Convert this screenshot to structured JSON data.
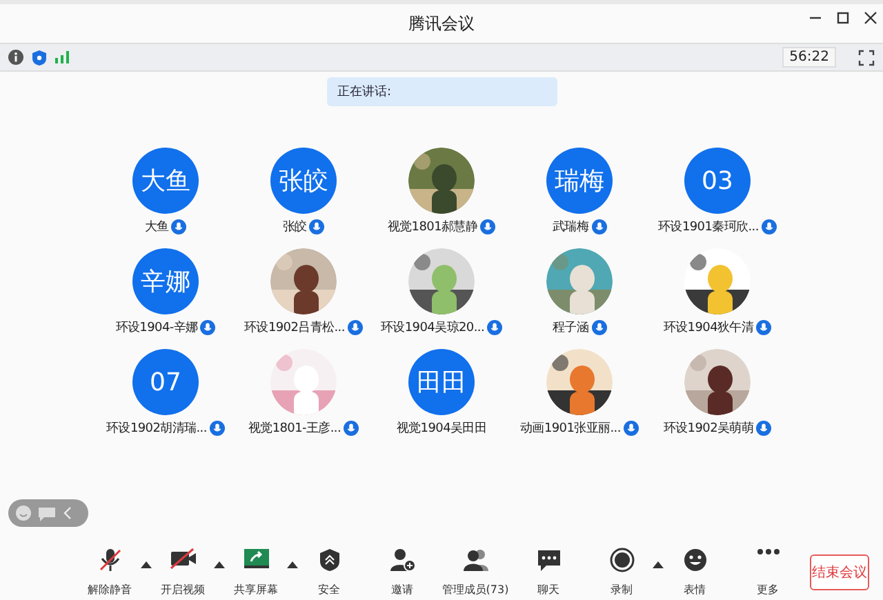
{
  "window": {
    "title": "腾讯会议"
  },
  "info_bar": {
    "timer": "56:22"
  },
  "speaking": {
    "label": "正在讲话:"
  },
  "participants": [
    {
      "name": "大鱼",
      "kind": "initials",
      "initials": "大鱼",
      "mic": true
    },
    {
      "name": "张皎",
      "kind": "initials",
      "initials": "张皎",
      "mic": true
    },
    {
      "name": "视觉1801郝慧静",
      "kind": "picture",
      "mic": true
    },
    {
      "name": "武瑞梅",
      "kind": "initials",
      "initials": "瑞梅",
      "mic": true
    },
    {
      "name": "环设1901秦珂欣...",
      "kind": "initials",
      "initials": "03",
      "mic": true
    },
    {
      "name": "环设1904-辛娜",
      "kind": "initials",
      "initials": "辛娜",
      "mic": true
    },
    {
      "name": "环设1902吕青松...",
      "kind": "picture",
      "mic": true
    },
    {
      "name": "环设1904吴琼20...",
      "kind": "picture",
      "mic": true
    },
    {
      "name": "程子涵",
      "kind": "picture",
      "mic": true
    },
    {
      "name": "环设1904狄午清",
      "kind": "picture",
      "mic": true
    },
    {
      "name": "环设1902胡清瑞...",
      "kind": "initials",
      "initials": "07",
      "mic": true
    },
    {
      "name": "视觉1801-王彦...",
      "kind": "picture",
      "mic": true
    },
    {
      "name": "视觉1904吴田田",
      "kind": "initials",
      "initials": "田田",
      "mic": false
    },
    {
      "name": "动画1901张亚丽...",
      "kind": "picture",
      "mic": true
    },
    {
      "name": "环设1902吴萌萌",
      "kind": "picture",
      "mic": true
    }
  ],
  "toolbar": [
    {
      "label": "解除静音",
      "caret": true
    },
    {
      "label": "开启视频",
      "caret": true
    },
    {
      "label": "共享屏幕",
      "caret": true
    },
    {
      "label": "安全",
      "caret": false
    },
    {
      "label": "邀请",
      "caret": false
    },
    {
      "label": "管理成员(73)",
      "caret": false
    },
    {
      "label": "聊天",
      "caret": false
    },
    {
      "label": "录制",
      "caret": true
    },
    {
      "label": "表情",
      "caret": false
    },
    {
      "label": "更多",
      "caret": false
    }
  ],
  "end_button": {
    "label": "结束会议"
  }
}
